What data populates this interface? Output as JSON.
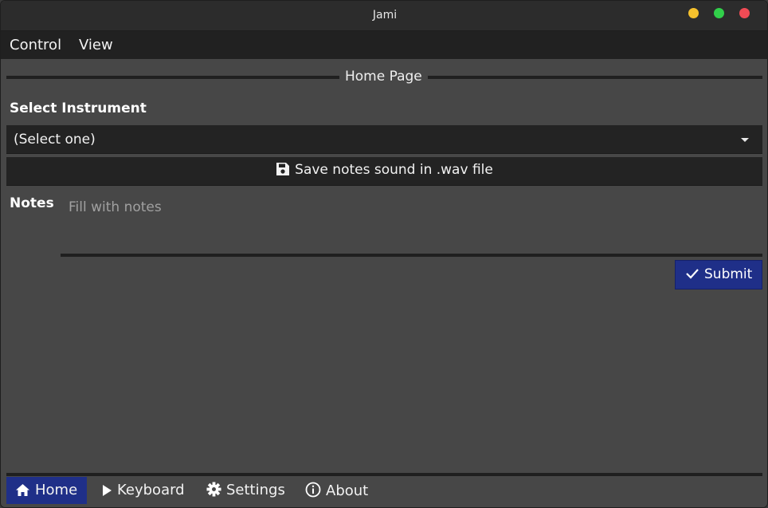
{
  "window": {
    "title": "Jami"
  },
  "menubar": {
    "items": [
      {
        "label": "Control"
      },
      {
        "label": "View"
      }
    ]
  },
  "page": {
    "title": "Home Page"
  },
  "instrument": {
    "label": "Select Instrument",
    "selected": "(Select one)"
  },
  "save": {
    "label": "Save notes sound in .wav file",
    "icon": "floppy-disk-icon"
  },
  "notes": {
    "label": "Notes",
    "placeholder": "Fill with notes",
    "value": ""
  },
  "submit": {
    "label": "Submit",
    "icon": "checkmark-icon"
  },
  "tabs": [
    {
      "label": "Home",
      "icon": "home-icon",
      "active": true
    },
    {
      "label": "Keyboard",
      "icon": "play-icon",
      "active": false
    },
    {
      "label": "Settings",
      "icon": "gear-icon",
      "active": false
    },
    {
      "label": "About",
      "icon": "info-icon",
      "active": false
    }
  ],
  "colors": {
    "accent": "#1f2f88",
    "background": "#474747",
    "control": "#232323"
  }
}
